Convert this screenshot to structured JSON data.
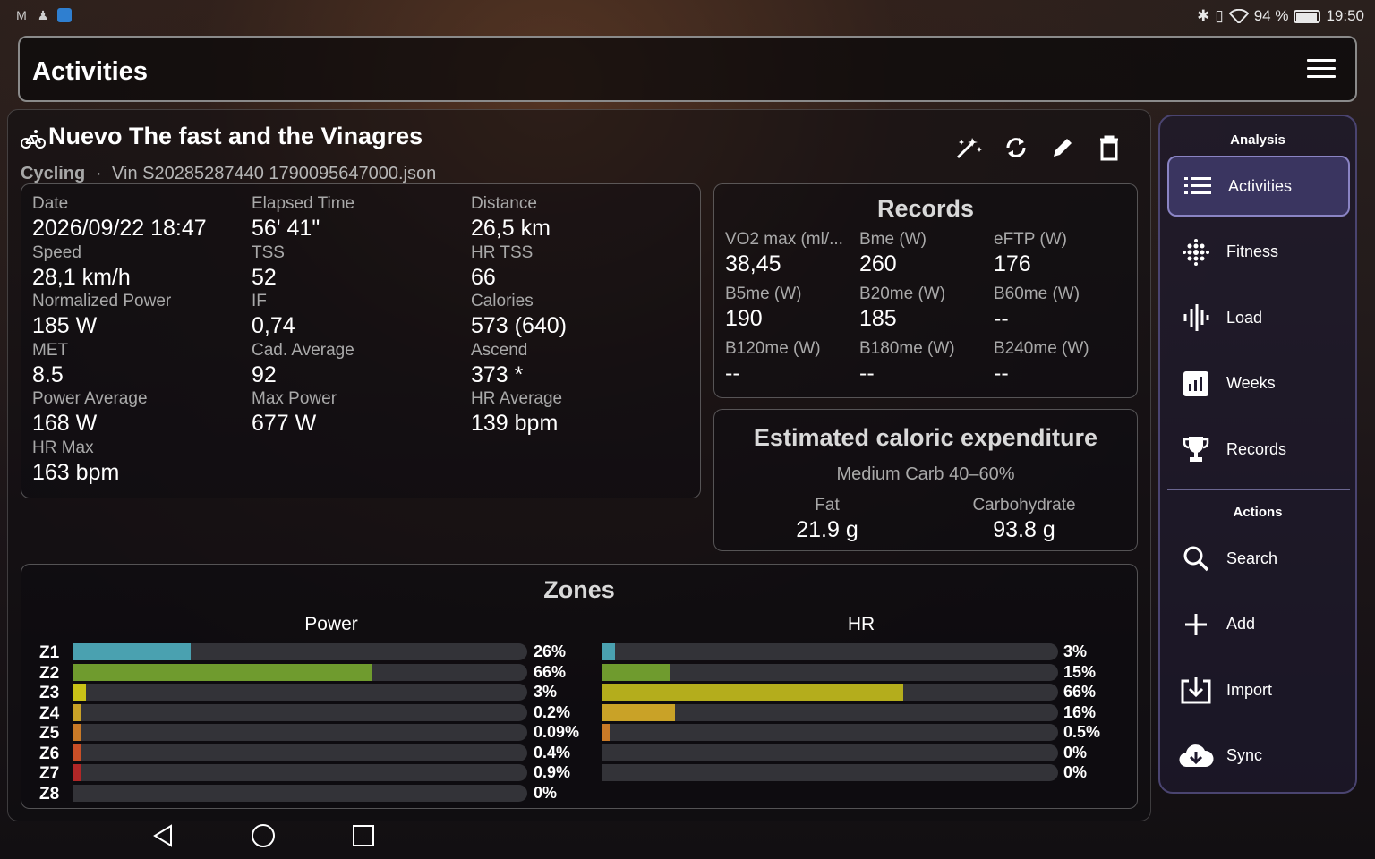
{
  "status_bar": {
    "battery_percent": "94 %",
    "battery_level": 0.94,
    "time": "19:50"
  },
  "app_bar": {
    "title": "Activities"
  },
  "activity": {
    "title": "Nuevo The fast and the Vinagres",
    "sport": "Cycling",
    "separator": "·",
    "file": "Vin S20285287440 1790095647000.json",
    "actions": [
      "magic-wand-icon",
      "sync-icon",
      "edit-icon",
      "delete-icon"
    ]
  },
  "summary": {
    "col1": [
      {
        "label": "Date",
        "value": "2026/09/22 18:47"
      },
      {
        "label": "Speed",
        "value": "28,1 km/h"
      },
      {
        "label": "Normalized Power",
        "value": "185 W"
      },
      {
        "label": "MET",
        "value": "8.5"
      },
      {
        "label": "Power Average",
        "value": "168 W"
      },
      {
        "label": "HR Max",
        "value": "163 bpm"
      }
    ],
    "col2": [
      {
        "label": "Elapsed Time",
        "value": "56' 41\""
      },
      {
        "label": "TSS",
        "value": "52"
      },
      {
        "label": "IF",
        "value": "0,74"
      },
      {
        "label": "Cad. Average",
        "value": "92"
      },
      {
        "label": "Max Power",
        "value": "677 W"
      }
    ],
    "col3": [
      {
        "label": "Distance",
        "value": "26,5 km"
      },
      {
        "label": "HR TSS",
        "value": "66"
      },
      {
        "label": "Calories",
        "value": "573 (640)"
      },
      {
        "label": "Ascend",
        "value": "373 *"
      },
      {
        "label": "HR Average",
        "value": "139 bpm"
      }
    ]
  },
  "records": {
    "title": "Records",
    "rows": [
      [
        {
          "label": "VO2 max (ml/...",
          "value": "38,45"
        },
        {
          "label": "Bme (W)",
          "value": "260"
        },
        {
          "label": "eFTP (W)",
          "value": "176"
        }
      ],
      [
        {
          "label": "B5me (W)",
          "value": "190"
        },
        {
          "label": "B20me (W)",
          "value": "185"
        },
        {
          "label": "B60me (W)",
          "value": "--"
        }
      ],
      [
        {
          "label": "B120me (W)",
          "value": "--"
        },
        {
          "label": "B180me (W)",
          "value": "--"
        },
        {
          "label": "B240me (W)",
          "value": "--"
        }
      ]
    ]
  },
  "caloric": {
    "title": "Estimated caloric expenditure",
    "subtitle": "Medium Carb 40–60%",
    "fat_label": "Fat",
    "fat_value": "21.9 g",
    "carb_label": "Carbohydrate",
    "carb_value": "93.8 g"
  },
  "zones": {
    "title": "Zones",
    "power_label": "Power",
    "hr_label": "HR",
    "labels": [
      "Z1",
      "Z2",
      "Z3",
      "Z4",
      "Z5",
      "Z6",
      "Z7",
      "Z8"
    ],
    "power": [
      {
        "pct": "26%",
        "value": 0.26,
        "color": "#4aa1b0"
      },
      {
        "pct": "66%",
        "value": 0.66,
        "color": "#6f9b2e"
      },
      {
        "pct": "3%",
        "value": 0.03,
        "color": "#c9c217"
      },
      {
        "pct": "0.2%",
        "value": 0.002,
        "color": "#c9a227"
      },
      {
        "pct": "0.09%",
        "value": 0.0009,
        "color": "#c97a27"
      },
      {
        "pct": "0.4%",
        "value": 0.004,
        "color": "#c94f27"
      },
      {
        "pct": "0.9%",
        "value": 0.009,
        "color": "#b02727"
      },
      {
        "pct": "0%",
        "value": 0,
        "color": "#801010"
      }
    ],
    "hr": [
      {
        "pct": "3%",
        "value": 0.03,
        "color": "#4aa1b0"
      },
      {
        "pct": "15%",
        "value": 0.15,
        "color": "#6f9b2e"
      },
      {
        "pct": "66%",
        "value": 0.66,
        "color": "#b4ad1c"
      },
      {
        "pct": "16%",
        "value": 0.16,
        "color": "#c9a227"
      },
      {
        "pct": "0.5%",
        "value": 0.005,
        "color": "#c97a27"
      },
      {
        "pct": "0%",
        "value": 0,
        "color": "#c94f27"
      },
      {
        "pct": "0%",
        "value": 0,
        "color": "#b02727"
      }
    ]
  },
  "sidenav": {
    "analysis_title": "Analysis",
    "analysis_items": [
      {
        "label": "Activities",
        "icon": "list-icon",
        "active": true
      },
      {
        "label": "Fitness",
        "icon": "dots-icon"
      },
      {
        "label": "Load",
        "icon": "waveform-icon"
      },
      {
        "label": "Weeks",
        "icon": "chart-icon"
      },
      {
        "label": "Records",
        "icon": "trophy-icon"
      }
    ],
    "actions_title": "Actions",
    "action_items": [
      {
        "label": "Search",
        "icon": "search-icon"
      },
      {
        "label": "Add",
        "icon": "plus-icon"
      },
      {
        "label": "Import",
        "icon": "import-icon"
      },
      {
        "label": "Sync",
        "icon": "cloud-download-icon"
      }
    ]
  },
  "colors": {
    "accent": "#8a84c4",
    "nav_background": "#1e192e",
    "zone_track": "#333338"
  }
}
